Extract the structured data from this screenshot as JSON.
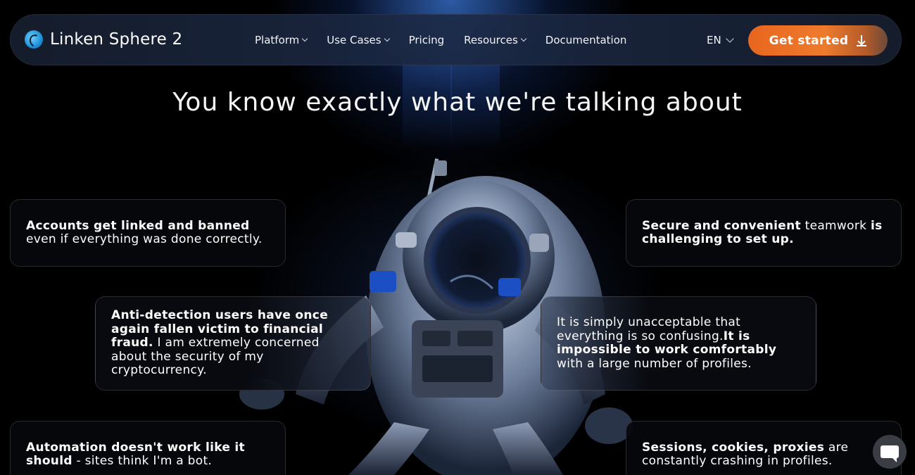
{
  "brand": {
    "name": "Linken Sphere 2"
  },
  "nav": {
    "items": [
      {
        "label": "Platform",
        "dropdown": true
      },
      {
        "label": "Use Cases",
        "dropdown": true
      },
      {
        "label": "Pricing",
        "dropdown": false
      },
      {
        "label": "Resources",
        "dropdown": true
      },
      {
        "label": "Documentation",
        "dropdown": false
      }
    ],
    "language": "EN",
    "cta_label": "Get started"
  },
  "hero": {
    "headline": "You know exactly what we're talking about"
  },
  "cards": [
    {
      "bold": "Accounts get linked and banned",
      "rest": " even if everything was done correctly."
    },
    {
      "bold": "Secure and convenient",
      "mid": " teamwork ",
      "bold2": "is challenging to set up."
    },
    {
      "bold": "Anti-detection users have once again fallen victim to financial fraud.",
      "rest": " I am extremely concerned about the security of my cryptocurrency."
    },
    {
      "pre": "It is simply unacceptable that everything is so confusing.",
      "bold": "It is impossible to work comfortably",
      "rest": " with a large number of profiles."
    },
    {
      "bold": "Automation doesn't work like it should",
      "rest": " - sites think I'm a bot."
    },
    {
      "bold": "Sessions, cookies, proxies",
      "rest": " are constantly crashing in profiles."
    }
  ],
  "colors": {
    "cta": "#e8661e",
    "background": "#000000",
    "accent_glow": "#3c78dc"
  },
  "icons": [
    "logo-icon",
    "chevron-down-icon",
    "download-icon",
    "chat-icon"
  ]
}
